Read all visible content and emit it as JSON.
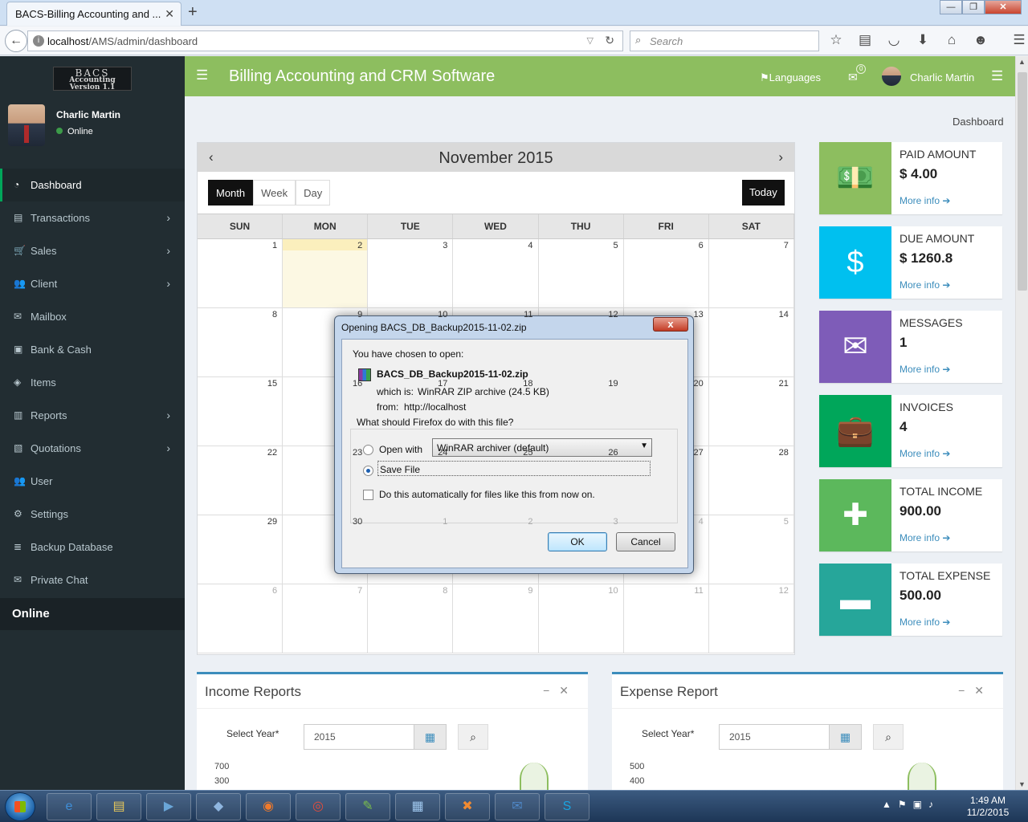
{
  "browser": {
    "tab_title": "BACS-Billing Accounting and ...",
    "tab_close": "✕",
    "new_tab": "+",
    "url_host": "localhost",
    "url_path": "/AMS/admin/dashboard",
    "search_placeholder": "Search",
    "window_buttons": [
      "—",
      "❐",
      "✕"
    ]
  },
  "sidebar": {
    "logo_lines": [
      "BACS",
      "Accounting",
      "Version 1.1"
    ],
    "user_name": "Charlic Martin",
    "user_status": "Online",
    "items": [
      {
        "label": "Dashboard",
        "icon": "tachometer-icon",
        "glyph": "◔",
        "chevron": ""
      },
      {
        "label": "Transactions",
        "icon": "list-icon",
        "glyph": "▤",
        "chevron": "›"
      },
      {
        "label": "Sales",
        "icon": "cart-icon",
        "glyph": "🛒",
        "chevron": "›"
      },
      {
        "label": "Client",
        "icon": "users-icon",
        "glyph": "👥",
        "chevron": "›"
      },
      {
        "label": "Mailbox",
        "icon": "envelope-icon",
        "glyph": "✉",
        "chevron": ""
      },
      {
        "label": "Bank & Cash",
        "icon": "money-icon",
        "glyph": "▣",
        "chevron": ""
      },
      {
        "label": "Items",
        "icon": "cube-icon",
        "glyph": "◈",
        "chevron": ""
      },
      {
        "label": "Reports",
        "icon": "bar-chart-icon",
        "glyph": "▥",
        "chevron": "›"
      },
      {
        "label": "Quotations",
        "icon": "file-icon",
        "glyph": "▧",
        "chevron": "›"
      },
      {
        "label": "User",
        "icon": "user-group-icon",
        "glyph": "👥",
        "chevron": ""
      },
      {
        "label": "Settings",
        "icon": "gears-icon",
        "glyph": "⚙",
        "chevron": ""
      },
      {
        "label": "Backup Database",
        "icon": "database-icon",
        "glyph": "≣",
        "chevron": ""
      },
      {
        "label": "Private Chat",
        "icon": "envelope-icon",
        "glyph": "✉",
        "chevron": ""
      }
    ],
    "online_header": "Online"
  },
  "header": {
    "title": "Billing Accounting and CRM Software",
    "languages": "Languages",
    "mail_count": "0",
    "user_name": "Charlic Martin",
    "accent": "#8dbe5f"
  },
  "breadcrumb": "Dashboard",
  "calendar": {
    "month_title": "November 2015",
    "views": [
      "Month",
      "Week",
      "Day"
    ],
    "today_label": "Today",
    "days_of_week": [
      "SUN",
      "MON",
      "TUE",
      "WED",
      "THU",
      "FRI",
      "SAT"
    ],
    "weeks": [
      [
        "1",
        "2",
        "3",
        "4",
        "5",
        "6",
        "7"
      ],
      [
        "8",
        "9",
        "10",
        "11",
        "12",
        "13",
        "14"
      ],
      [
        "15",
        "16",
        "17",
        "18",
        "19",
        "20",
        "21"
      ],
      [
        "22",
        "23",
        "24",
        "25",
        "26",
        "27",
        "28"
      ],
      [
        "29",
        "30",
        "1",
        "2",
        "3",
        "4",
        "5"
      ],
      [
        "6",
        "7",
        "8",
        "9",
        "10",
        "11",
        "12"
      ]
    ]
  },
  "info_boxes": [
    {
      "label": "PAID AMOUNT",
      "value": "$ 4.00",
      "more": "More info",
      "color": "#8dbe5f",
      "icon": "money-bill-icon",
      "glyph": "💵"
    },
    {
      "label": "DUE AMOUNT",
      "value": "$ 1260.8",
      "more": "More info",
      "color": "#00c0ef",
      "icon": "dollar-icon",
      "glyph": "$"
    },
    {
      "label": "MESSAGES",
      "value": "1",
      "more": "More info",
      "color": "#7e5cb8",
      "icon": "envelope-icon",
      "glyph": "✉"
    },
    {
      "label": "INVOICES",
      "value": "4",
      "more": "More info",
      "color": "#00a65a",
      "icon": "briefcase-icon",
      "glyph": "💼"
    },
    {
      "label": "TOTAL INCOME",
      "value": "900.00",
      "more": "More info",
      "color": "#5cb85c",
      "icon": "plus-icon",
      "glyph": "✚"
    },
    {
      "label": "TOTAL EXPENSE",
      "value": "500.00",
      "more": "More info",
      "color": "#26a69a",
      "icon": "minus-icon",
      "glyph": "▬"
    }
  ],
  "income_panel": {
    "title": "Income Reports",
    "select_label": "Select Year*",
    "year": "2015",
    "y_ticks": [
      "700",
      "300"
    ]
  },
  "expense_panel": {
    "title": "Expense Report",
    "select_label": "Select Year*",
    "year": "2015",
    "y_ticks": [
      "500",
      "400"
    ]
  },
  "dialog": {
    "title": "Opening BACS_DB_Backup2015-11-02.zip",
    "close": "x",
    "chosen": "You have chosen to open:",
    "filename": "BACS_DB_Backup2015-11-02.zip",
    "which_label": "which is:",
    "which_value": "WinRAR ZIP archive (24.5 KB)",
    "from_label": "from:",
    "from_value": "http://localhost",
    "question": "What should Firefox do with this file?",
    "open_with": "Open with",
    "app": "WinRAR archiver (default)",
    "save_file": "Save File",
    "auto_label": "Do this automatically for files like this from now on.",
    "ok": "OK",
    "cancel": "Cancel"
  },
  "taskbar": {
    "time": "1:49 AM",
    "date": "11/2/2015",
    "apps": [
      "ie-icon",
      "explorer-icon",
      "kmplayer-icon",
      "virtualbox-icon",
      "firefox-icon",
      "chrome-icon",
      "notepad-icon",
      "calculator-icon",
      "xampp-icon",
      "thunderbird-icon",
      "skype-icon"
    ]
  }
}
